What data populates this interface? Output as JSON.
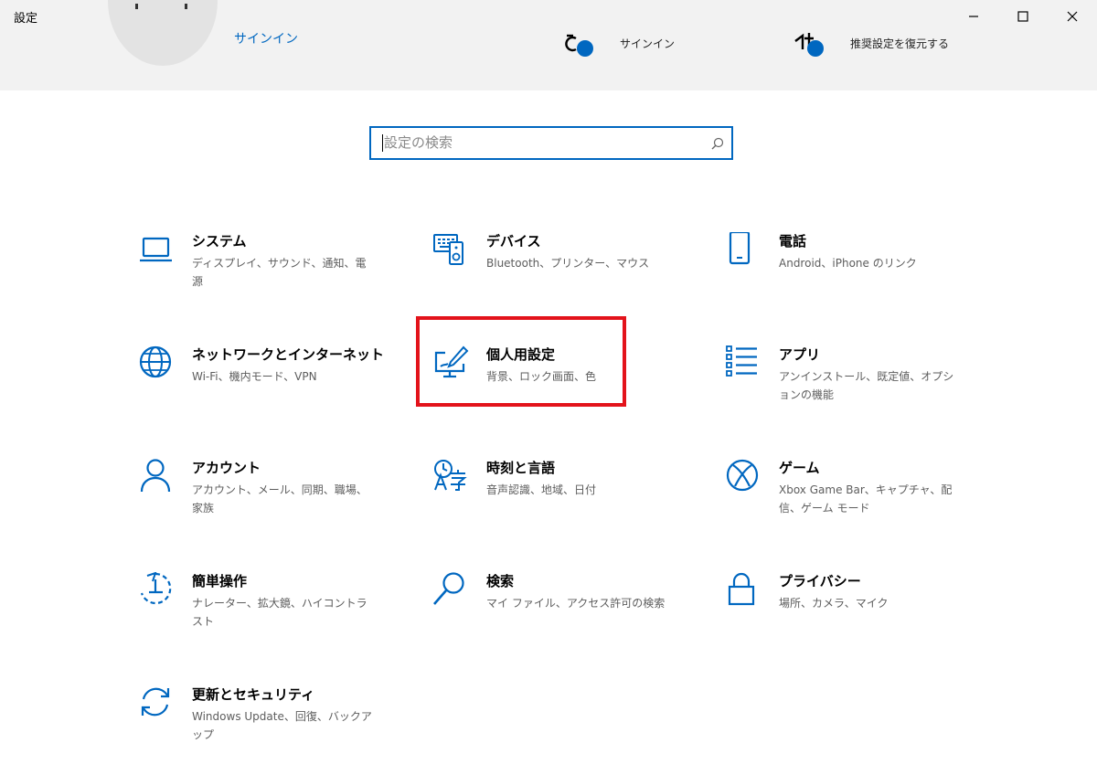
{
  "window": {
    "title": "設定"
  },
  "account": {
    "signin_link": "サインイン"
  },
  "top_items": [
    {
      "label": "サインイン",
      "icon": "onedrive-icon"
    },
    {
      "label": "推奨設定を復元する",
      "icon": "windows-update-icon"
    }
  ],
  "search": {
    "placeholder": "設定の検索",
    "value": ""
  },
  "tiles": [
    {
      "title": "システム",
      "desc": "ディスプレイ、サウンド、通知、電源",
      "icon": "laptop-icon"
    },
    {
      "title": "デバイス",
      "desc": "Bluetooth、プリンター、マウス",
      "icon": "keyboard-speaker-icon"
    },
    {
      "title": "電話",
      "desc": "Android、iPhone のリンク",
      "icon": "phone-icon"
    },
    {
      "title": "ネットワークとインターネット",
      "desc": "Wi-Fi、機内モード、VPN",
      "icon": "globe-icon"
    },
    {
      "title": "個人用設定",
      "desc": "背景、ロック画面、色",
      "icon": "pen-monitor-icon"
    },
    {
      "title": "アプリ",
      "desc": "アンインストール、既定値、オプションの機能",
      "icon": "app-list-icon"
    },
    {
      "title": "アカウント",
      "desc": "アカウント、メール、同期、職場、家族",
      "icon": "person-icon"
    },
    {
      "title": "時刻と言語",
      "desc": "音声認識、地域、日付",
      "icon": "time-language-icon"
    },
    {
      "title": "ゲーム",
      "desc": "Xbox Game Bar、キャプチャ、配信、ゲーム モード",
      "icon": "xbox-icon"
    },
    {
      "title": "簡単操作",
      "desc": "ナレーター、拡大鏡、ハイコントラスト",
      "icon": "ease-of-access-icon"
    },
    {
      "title": "検索",
      "desc": "マイ ファイル、アクセス許可の検索",
      "icon": "search-icon"
    },
    {
      "title": "プライバシー",
      "desc": "場所、カメラ、マイク",
      "icon": "lock-icon"
    },
    {
      "title": "更新とセキュリティ",
      "desc": "Windows Update、回復、バックアップ",
      "icon": "sync-icon"
    }
  ],
  "colors": {
    "accent": "#0067c0",
    "highlight": "#e3131b",
    "header_bg": "#f2f2f2"
  }
}
